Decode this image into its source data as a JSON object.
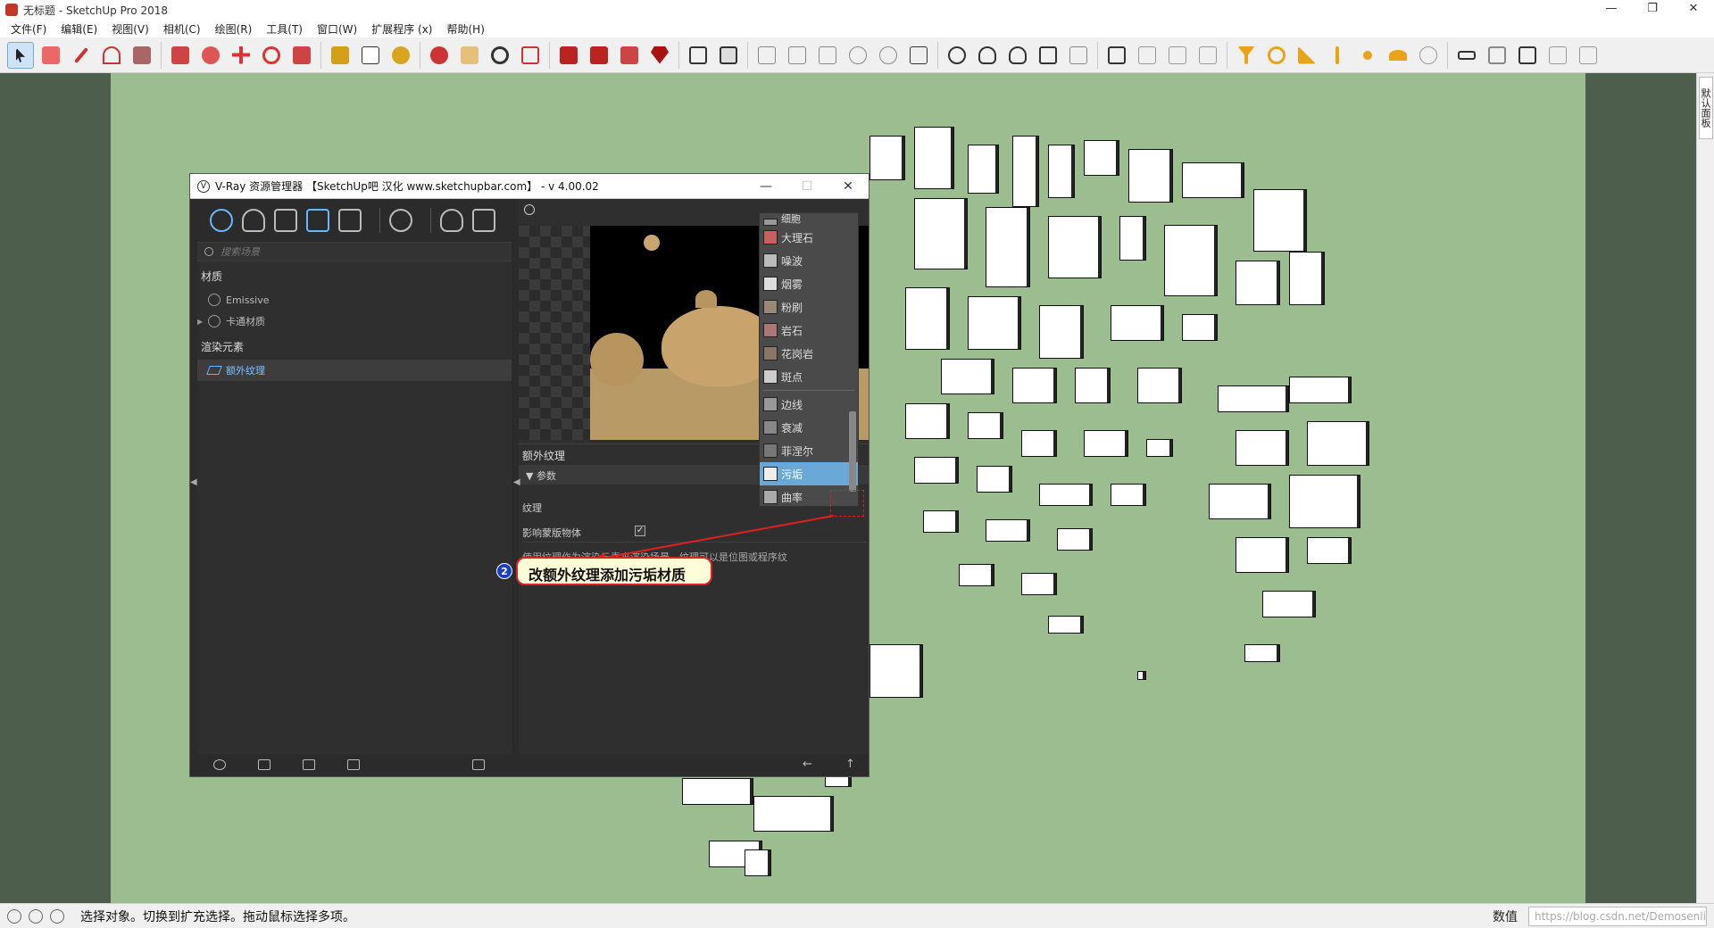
{
  "app": {
    "title": "无标题 - SketchUp Pro 2018",
    "win_min": "—",
    "win_max": "❐",
    "win_close": "✕"
  },
  "menu": {
    "items": [
      "文件(F)",
      "编辑(E)",
      "视图(V)",
      "相机(C)",
      "绘图(R)",
      "工具(T)",
      "窗口(W)",
      "扩展程序 (x)",
      "帮助(H)"
    ]
  },
  "tray": {
    "tab_label": "默认面板"
  },
  "status": {
    "message": "选择对象。切换到扩充选择。拖动鼠标选择多项。",
    "value_label": "数值",
    "value_field": "https://blog.csdn.net/Demosenli"
  },
  "vray": {
    "title": "V-Ray 资源管理器 【SketchUp吧 汉化 www.sketchupbar.com】 - v 4.00.02",
    "search_placeholder": "搜索场景",
    "section_materials": "材质",
    "item_emissive": "Emissive",
    "item_toon": "卡通材质",
    "section_render_elements": "渲染元素",
    "item_extra_texture": "额外纹理",
    "header_extra_texture": "额外纹理",
    "params_label": "参数",
    "row_texture": "纹理",
    "row_affect_matte": "影响蒙版物体",
    "affect_matte_checked": "✓",
    "description": "使用纹理作为渲染元素来渲染场景。纹理可以是位图或程序纹",
    "dropdown": {
      "top_cut": "细胞",
      "items": [
        {
          "label": "大理石",
          "color": "#c86060"
        },
        {
          "label": "噪波",
          "color": "#bbbbbb"
        },
        {
          "label": "烟雾",
          "color": "#dddddd"
        },
        {
          "label": "粉刷",
          "color": "#998877"
        },
        {
          "label": "岩石",
          "color": "#aa7777"
        },
        {
          "label": "花岗岩",
          "color": "#887766"
        },
        {
          "label": "斑点",
          "color": "#cccccc"
        }
      ],
      "items2": [
        {
          "label": "边线",
          "color": "#999999"
        },
        {
          "label": "衰减",
          "color": "#888888"
        },
        {
          "label": "菲涅尔",
          "color": "#777777"
        },
        {
          "label": "污垢",
          "color": "#eeeeee"
        },
        {
          "label": "曲率",
          "color": "#aaaaaa"
        }
      ],
      "selected": "污垢"
    }
  },
  "annotation": {
    "step": "2",
    "text": "改额外纹理添加污垢材质",
    "color": "#e02020"
  }
}
